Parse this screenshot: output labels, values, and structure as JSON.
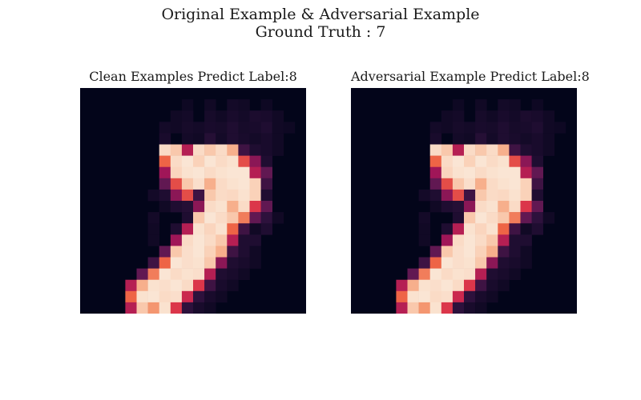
{
  "figure": {
    "title_line1": "Original Example & Adversarial Example",
    "title_line2": "Ground Truth : 7"
  },
  "chart_data": [
    {
      "type": "heatmap",
      "title": "Clean Examples Predict Label:8",
      "colormap": "rocket",
      "background_color": "#03051a",
      "grid": false,
      "values": [
        [
          0,
          0,
          0,
          0,
          0,
          0,
          0,
          0,
          0,
          0,
          0,
          0,
          0,
          0,
          0,
          0,
          0,
          0,
          0,
          0
        ],
        [
          0,
          0,
          0,
          0,
          0,
          0,
          0,
          0,
          0,
          0.04,
          0,
          0.05,
          0,
          0.06,
          0.05,
          0,
          0.04,
          0,
          0,
          0
        ],
        [
          0,
          0,
          0,
          0,
          0,
          0,
          0,
          0,
          0.05,
          0.06,
          0,
          0.07,
          0.05,
          0.08,
          0.06,
          0.09,
          0.08,
          0.05,
          0,
          0
        ],
        [
          0,
          0,
          0,
          0,
          0,
          0,
          0,
          0.06,
          0.05,
          0.07,
          0.06,
          0.08,
          0.07,
          0.1,
          0.07,
          0.08,
          0.1,
          0.05,
          0.04,
          0
        ],
        [
          0,
          0,
          0,
          0,
          0,
          0,
          0,
          0.08,
          0,
          0.06,
          0.05,
          0.12,
          0.06,
          0.1,
          0.08,
          0.06,
          0.08,
          0.05,
          0,
          0
        ],
        [
          0,
          0,
          0,
          0,
          0,
          0,
          0,
          0.95,
          0.9,
          0.5,
          0.95,
          0.9,
          0.95,
          0.85,
          0.2,
          0.1,
          0.08,
          0.05,
          0,
          0
        ],
        [
          0,
          0,
          0,
          0,
          0,
          0,
          0,
          0.7,
          0.95,
          0.98,
          0.92,
          0.98,
          0.95,
          0.97,
          0.65,
          0.4,
          0.1,
          0,
          0,
          0
        ],
        [
          0,
          0,
          0,
          0,
          0,
          0,
          0,
          0.45,
          0.93,
          0.97,
          0.98,
          0.95,
          0.97,
          0.98,
          0.98,
          0.5,
          0.3,
          0,
          0,
          0
        ],
        [
          0,
          0,
          0,
          0,
          0,
          0,
          0,
          0.3,
          0.65,
          0.9,
          0.96,
          0.85,
          0.95,
          0.97,
          0.98,
          0.92,
          0.2,
          0,
          0,
          0
        ],
        [
          0,
          0,
          0,
          0,
          0,
          0,
          0.06,
          0.1,
          0.4,
          0.65,
          0.2,
          0.9,
          0.95,
          0.94,
          0.97,
          0.92,
          0.1,
          0,
          0,
          0
        ],
        [
          0,
          0,
          0,
          0,
          0,
          0,
          0,
          0.05,
          0.1,
          0.12,
          0.4,
          0.95,
          0.97,
          0.85,
          0.95,
          0.6,
          0.3,
          0,
          0,
          0
        ],
        [
          0,
          0,
          0,
          0,
          0,
          0,
          0.06,
          0,
          0,
          0.1,
          0.9,
          0.98,
          0.95,
          0.9,
          0.75,
          0.3,
          0.15,
          0.05,
          0,
          0
        ],
        [
          0,
          0,
          0,
          0,
          0,
          0,
          0.05,
          0,
          0.1,
          0.5,
          0.97,
          0.93,
          0.97,
          0.7,
          0.2,
          0.05,
          0.1,
          0,
          0,
          0
        ],
        [
          0,
          0,
          0,
          0,
          0,
          0,
          0.05,
          0,
          0.45,
          0.95,
          0.98,
          0.95,
          0.9,
          0.5,
          0.1,
          0.1,
          0,
          0,
          0,
          0
        ],
        [
          0,
          0,
          0,
          0,
          0,
          0,
          0,
          0.3,
          0.9,
          0.96,
          0.98,
          0.92,
          0.85,
          0.2,
          0.1,
          0.05,
          0,
          0,
          0,
          0
        ],
        [
          0,
          0,
          0,
          0,
          0,
          0,
          0.2,
          0.7,
          0.98,
          0.96,
          0.97,
          0.9,
          0.4,
          0.1,
          0.08,
          0.05,
          0,
          0,
          0,
          0
        ],
        [
          0,
          0,
          0,
          0,
          0,
          0.3,
          0.75,
          0.98,
          0.95,
          0.97,
          0.96,
          0.5,
          0.1,
          0.08,
          0.05,
          0,
          0,
          0,
          0,
          0
        ],
        [
          0,
          0,
          0,
          0,
          0.5,
          0.85,
          0.97,
          0.96,
          0.98,
          0.95,
          0.6,
          0.2,
          0.08,
          0.05,
          0,
          0,
          0,
          0,
          0,
          0
        ],
        [
          0,
          0,
          0,
          0,
          0.7,
          0.97,
          0.98,
          0.95,
          0.96,
          0.55,
          0.15,
          0.08,
          0.05,
          0,
          0,
          0,
          0,
          0,
          0,
          0
        ],
        [
          0,
          0,
          0,
          0,
          0.5,
          0.9,
          0.8,
          0.97,
          0.6,
          0.15,
          0.08,
          0.05,
          0,
          0,
          0,
          0,
          0,
          0,
          0,
          0
        ]
      ]
    },
    {
      "type": "heatmap",
      "title": "Adversarial Example Predict Label:8",
      "colormap": "rocket",
      "background_color": "#03051a",
      "grid": false,
      "values": [
        [
          0,
          0,
          0,
          0,
          0,
          0,
          0,
          0,
          0,
          0,
          0,
          0,
          0,
          0,
          0,
          0,
          0,
          0,
          0,
          0
        ],
        [
          0,
          0,
          0,
          0,
          0,
          0,
          0,
          0,
          0,
          0.04,
          0,
          0.05,
          0,
          0.06,
          0.05,
          0,
          0.04,
          0,
          0,
          0
        ],
        [
          0,
          0,
          0,
          0,
          0,
          0,
          0,
          0,
          0.05,
          0.06,
          0,
          0.07,
          0.05,
          0.08,
          0.06,
          0.09,
          0.08,
          0.05,
          0,
          0
        ],
        [
          0,
          0,
          0,
          0,
          0,
          0,
          0,
          0.06,
          0.05,
          0.07,
          0.06,
          0.08,
          0.07,
          0.1,
          0.07,
          0.08,
          0.1,
          0.05,
          0.04,
          0
        ],
        [
          0,
          0,
          0,
          0,
          0,
          0,
          0,
          0.08,
          0,
          0.06,
          0.05,
          0.12,
          0.06,
          0.1,
          0.08,
          0.06,
          0.08,
          0.05,
          0,
          0
        ],
        [
          0,
          0,
          0,
          0,
          0,
          0,
          0,
          0.95,
          0.9,
          0.5,
          0.95,
          0.9,
          0.95,
          0.85,
          0.2,
          0.1,
          0.08,
          0.05,
          0,
          0
        ],
        [
          0,
          0,
          0,
          0,
          0,
          0,
          0,
          0.7,
          0.95,
          0.98,
          0.92,
          0.98,
          0.95,
          0.97,
          0.65,
          0.4,
          0.1,
          0,
          0,
          0
        ],
        [
          0,
          0,
          0,
          0,
          0,
          0,
          0,
          0.45,
          0.93,
          0.97,
          0.98,
          0.95,
          0.97,
          0.98,
          0.98,
          0.5,
          0.3,
          0,
          0,
          0
        ],
        [
          0,
          0,
          0,
          0,
          0,
          0,
          0,
          0.3,
          0.65,
          0.9,
          0.96,
          0.85,
          0.95,
          0.97,
          0.98,
          0.92,
          0.2,
          0,
          0,
          0
        ],
        [
          0,
          0,
          0,
          0,
          0,
          0,
          0.06,
          0.1,
          0.4,
          0.65,
          0.2,
          0.9,
          0.95,
          0.94,
          0.97,
          0.92,
          0.1,
          0,
          0,
          0
        ],
        [
          0,
          0,
          0,
          0,
          0,
          0,
          0,
          0.05,
          0.1,
          0.12,
          0.4,
          0.95,
          0.97,
          0.85,
          0.95,
          0.6,
          0.3,
          0,
          0,
          0
        ],
        [
          0,
          0,
          0,
          0,
          0,
          0,
          0.06,
          0,
          0,
          0.1,
          0.9,
          0.98,
          0.95,
          0.9,
          0.75,
          0.3,
          0.15,
          0.05,
          0,
          0
        ],
        [
          0,
          0,
          0,
          0,
          0,
          0,
          0.05,
          0,
          0.1,
          0.5,
          0.97,
          0.93,
          0.97,
          0.7,
          0.2,
          0.05,
          0.1,
          0,
          0,
          0
        ],
        [
          0,
          0,
          0,
          0,
          0,
          0,
          0.05,
          0,
          0.45,
          0.95,
          0.98,
          0.95,
          0.9,
          0.5,
          0.1,
          0.1,
          0,
          0,
          0,
          0
        ],
        [
          0,
          0,
          0,
          0,
          0,
          0,
          0,
          0.3,
          0.9,
          0.96,
          0.98,
          0.92,
          0.85,
          0.2,
          0.1,
          0.05,
          0,
          0,
          0,
          0
        ],
        [
          0,
          0,
          0,
          0,
          0,
          0,
          0.2,
          0.7,
          0.98,
          0.96,
          0.97,
          0.9,
          0.4,
          0.1,
          0.08,
          0.05,
          0,
          0,
          0,
          0
        ],
        [
          0,
          0,
          0,
          0,
          0,
          0.3,
          0.75,
          0.98,
          0.95,
          0.97,
          0.96,
          0.5,
          0.1,
          0.08,
          0.05,
          0,
          0,
          0,
          0,
          0
        ],
        [
          0,
          0,
          0,
          0,
          0.5,
          0.85,
          0.97,
          0.96,
          0.98,
          0.95,
          0.6,
          0.2,
          0.08,
          0.05,
          0,
          0,
          0,
          0,
          0,
          0
        ],
        [
          0,
          0,
          0,
          0,
          0.7,
          0.97,
          0.98,
          0.95,
          0.96,
          0.55,
          0.15,
          0.08,
          0.05,
          0,
          0,
          0,
          0,
          0,
          0,
          0
        ],
        [
          0,
          0,
          0,
          0,
          0.5,
          0.9,
          0.8,
          0.97,
          0.6,
          0.15,
          0.08,
          0.05,
          0,
          0,
          0,
          0,
          0,
          0,
          0,
          0
        ]
      ]
    }
  ]
}
